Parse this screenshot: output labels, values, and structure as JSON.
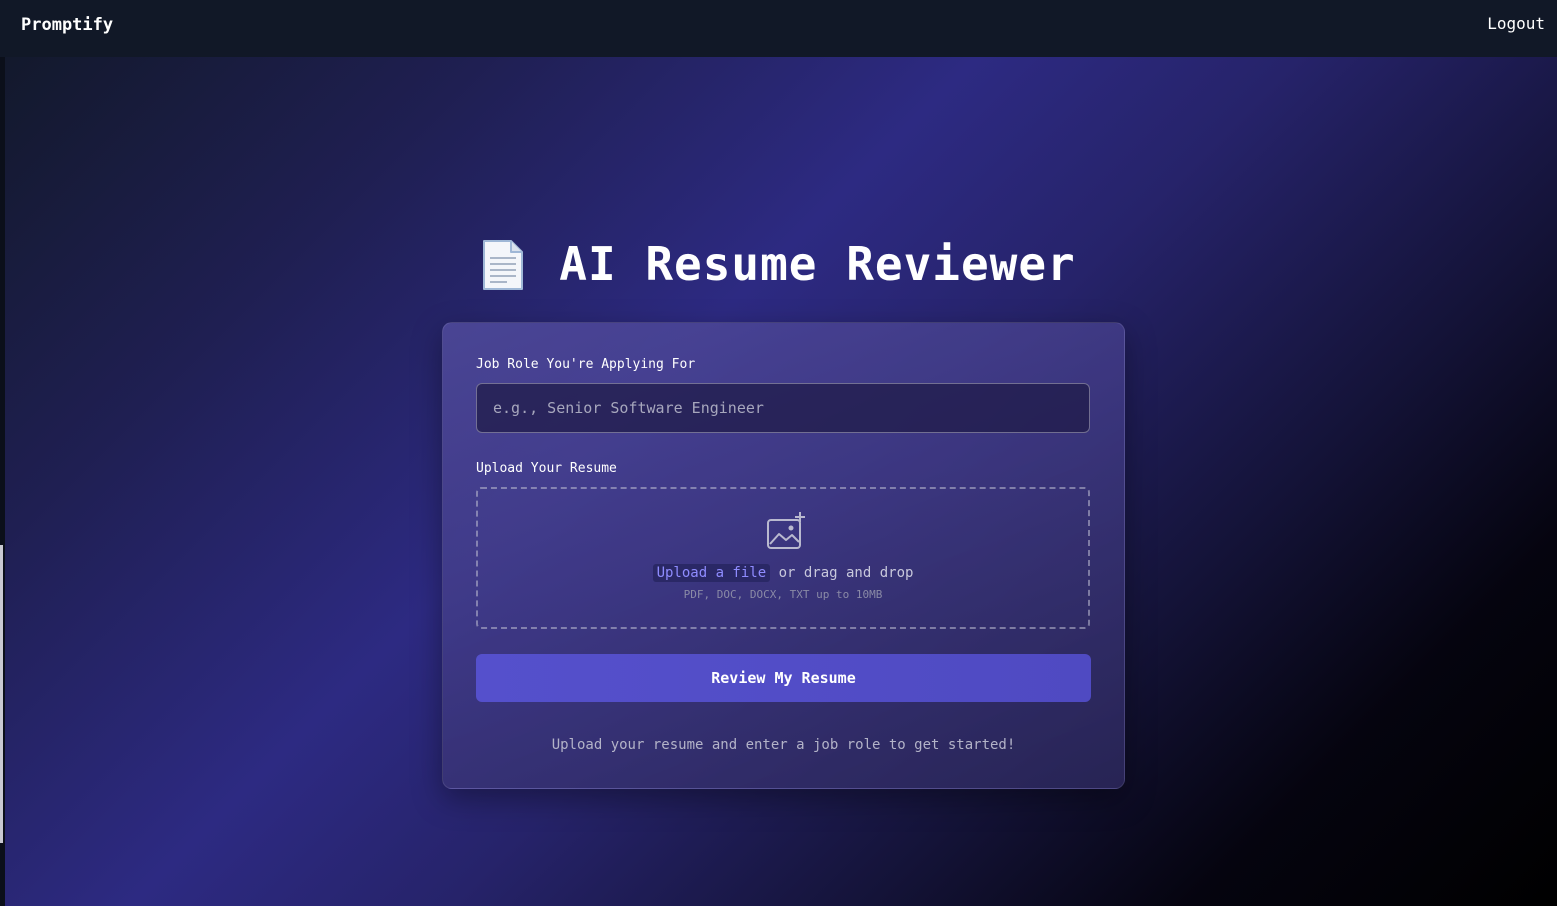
{
  "navbar": {
    "brand": "Promptify",
    "logout_label": "Logout"
  },
  "hero": {
    "icon": "document-icon",
    "title": "AI Resume Reviewer"
  },
  "form": {
    "job_role_label": "Job Role You're Applying For",
    "job_role_placeholder": "e.g., Senior Software Engineer",
    "job_role_value": "",
    "upload_label": "Upload Your Resume",
    "upload_icon": "image-add-icon",
    "upload_link": "Upload a file",
    "upload_drag_text": "or drag and drop",
    "upload_hint": "PDF, DOC, DOCX, TXT up to 10MB",
    "submit_label": "Review My Resume",
    "status_text": "Upload your resume and enter a job role to get started!"
  },
  "colors": {
    "accent": "#5550cc",
    "link": "#8f8cff",
    "navbar": "#111827"
  }
}
